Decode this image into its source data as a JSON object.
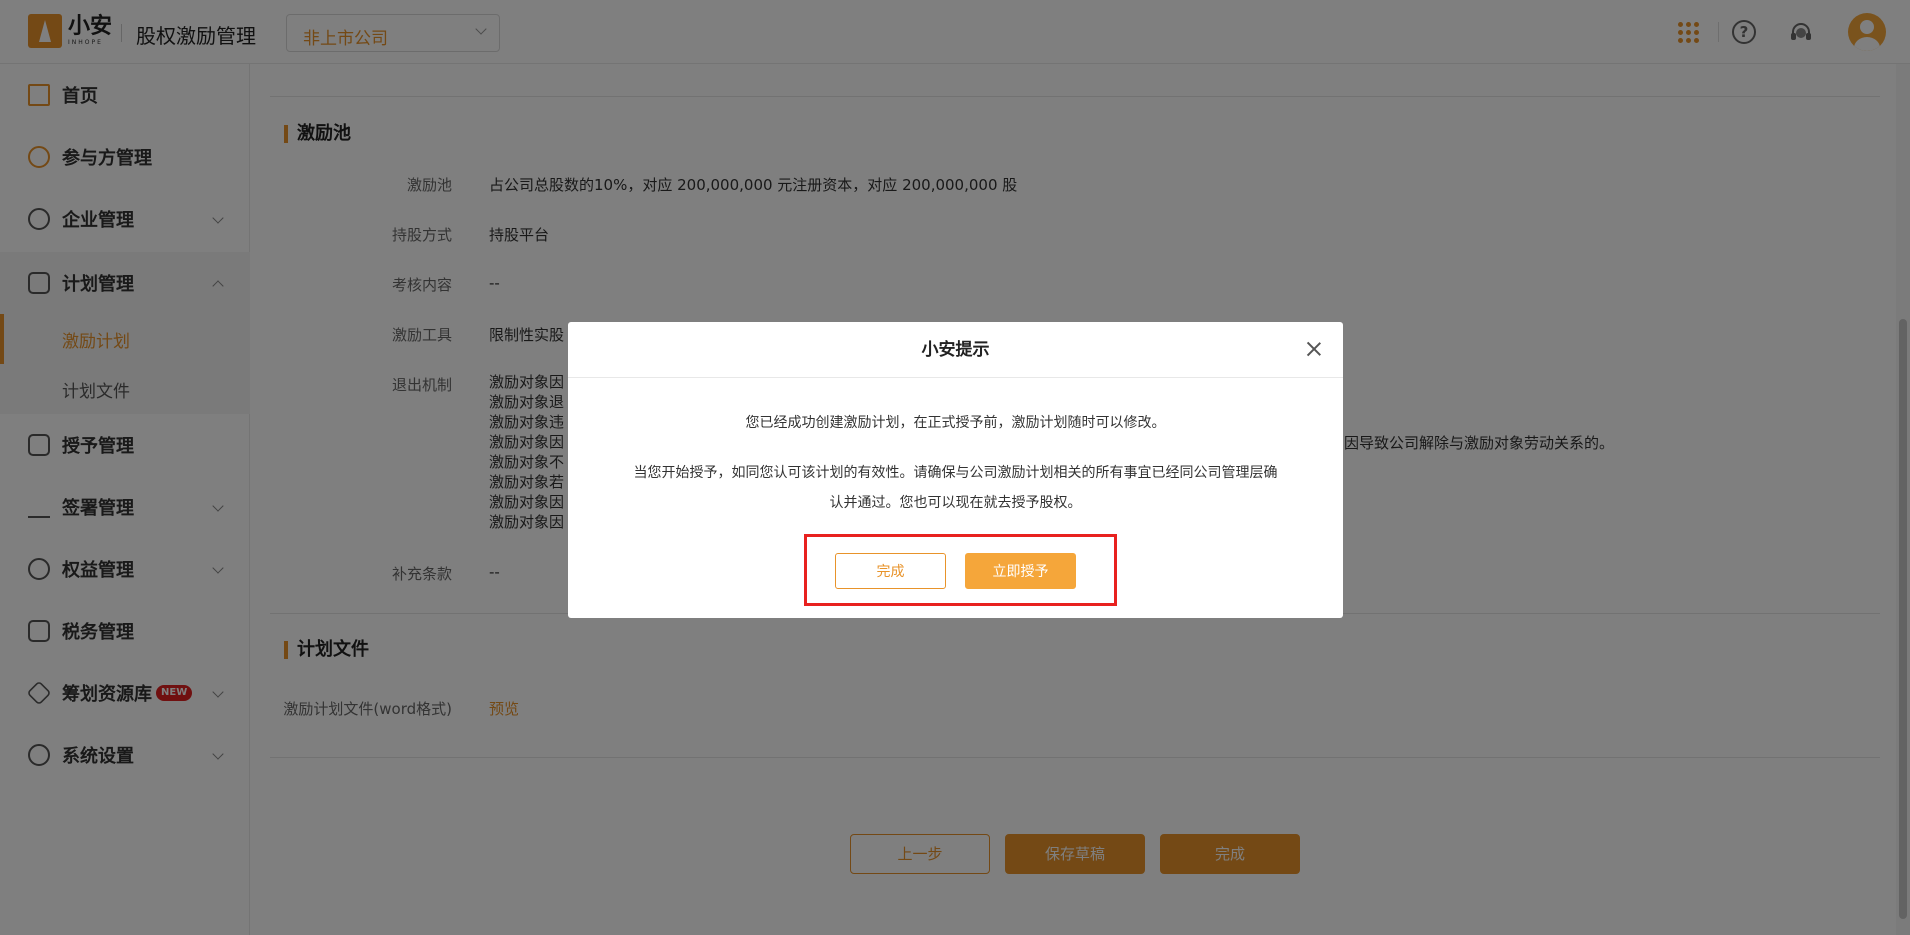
{
  "header": {
    "logo_cn": "小安",
    "logo_en": "INHOPE",
    "app_title": "股权激励管理",
    "company_select": "非上市公司"
  },
  "sidebar": {
    "items": [
      {
        "label": "首页"
      },
      {
        "label": "参与方管理"
      },
      {
        "label": "企业管理"
      },
      {
        "label": "计划管理"
      },
      {
        "label": "授予管理"
      },
      {
        "label": "签署管理"
      },
      {
        "label": "权益管理"
      },
      {
        "label": "税务管理"
      },
      {
        "label": "筹划资源库",
        "badge": "NEW"
      },
      {
        "label": "系统设置"
      }
    ],
    "sub_items": [
      {
        "label": "激励计划",
        "active": true
      },
      {
        "label": "计划文件",
        "active": false
      }
    ]
  },
  "pool_section": {
    "title": "激励池",
    "rows": [
      {
        "label": "激励池",
        "value": "占公司总股数的10%，对应 200,000,000 元注册资本，对应 200,000,000 股"
      },
      {
        "label": "持股方式",
        "value": "持股平台"
      },
      {
        "label": "考核内容",
        "value": "--"
      },
      {
        "label": "激励工具",
        "value": "限制性实股"
      },
      {
        "label": "退出机制",
        "value": ""
      },
      {
        "label": "补充条款",
        "value": "--"
      }
    ],
    "exit_lines": [
      "激励对象因",
      "激励对象退",
      "激励对象违",
      "激励对象因",
      "激励对象不",
      "激励对象若",
      "激励对象因",
      "激励对象因"
    ],
    "exit_tail": "因导致公司解除与激励对象劳动关系的。"
  },
  "file_section": {
    "title": "计划文件",
    "label": "激励计划文件(word格式)",
    "link": "预览"
  },
  "footer_buttons": {
    "prev": "上一步",
    "draft": "保存草稿",
    "finish": "完成"
  },
  "modal": {
    "title": "小安提示",
    "line1": "您已经成功创建激励计划，在正式授予前，激励计划随时可以修改。",
    "line2": "当您开始授予，如同您认可该计划的有效性。请确保与公司激励计划相关的所有事宜已经同公司管理层确认并通过。您也可以现在就去授予股权。",
    "done_label": "完成",
    "grant_label": "立即授予"
  },
  "colors": {
    "accent": "#e8932a",
    "highlight": "#e8211f"
  }
}
